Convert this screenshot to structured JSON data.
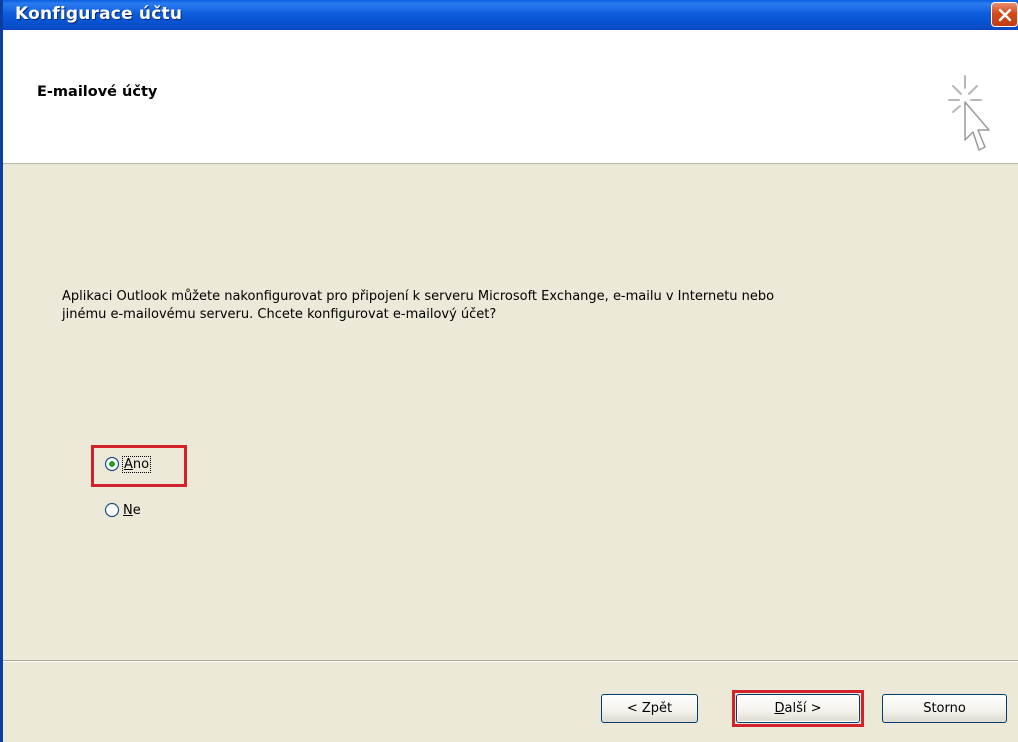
{
  "window": {
    "title": "Konfigurace účtu"
  },
  "header": {
    "title": "E-mailové účty",
    "icon": "wizard-cursor-icon"
  },
  "content": {
    "description": "Aplikaci Outlook můžete nakonfigurovat pro připojení k serveru Microsoft Exchange, e-mailu v Internetu nebo jinému e-mailovému serveru. Chcete konfigurovat e-mailový účet?",
    "options": [
      {
        "label": "Ano",
        "selected": true
      },
      {
        "label": "Ne",
        "selected": false
      }
    ]
  },
  "buttons": {
    "back": "< Zpět",
    "next": "Další >",
    "cancel": "Storno"
  },
  "colors": {
    "title_bar": "#0a5fe0",
    "dialog_bg": "#ece9d8",
    "highlight": "#d2232a"
  }
}
